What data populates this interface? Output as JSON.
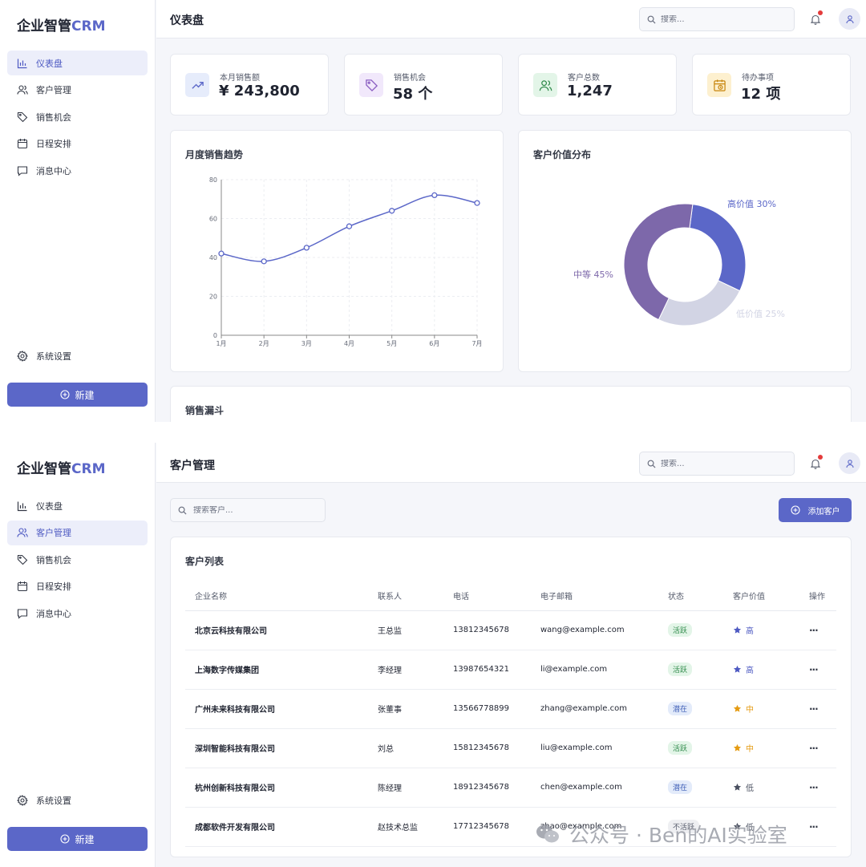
{
  "brand": {
    "name": "企业智管",
    "suffix": "CRM"
  },
  "nav": {
    "items": [
      {
        "label": "仪表盘",
        "icon": "bar-chart-icon"
      },
      {
        "label": "客户管理",
        "icon": "users-icon"
      },
      {
        "label": "销售机会",
        "icon": "tag-icon"
      },
      {
        "label": "日程安排",
        "icon": "calendar-icon"
      },
      {
        "label": "消息中心",
        "icon": "message-icon"
      }
    ],
    "settings_label": "系统设置",
    "new_label": "新建"
  },
  "header": {
    "search_placeholder": "搜索..."
  },
  "dashboard": {
    "title": "仪表盘",
    "stats": [
      {
        "label": "本月销售额",
        "value": "¥ 243,800",
        "icon": "trending-up-icon",
        "color": "#5b67c8",
        "bg": "#e6ecfb"
      },
      {
        "label": "销售机会",
        "value": "58 个",
        "icon": "tag-icon",
        "color": "#8b5fc2",
        "bg": "#f1e8fb"
      },
      {
        "label": "客户总数",
        "value": "1,247",
        "icon": "users-icon",
        "color": "#2f8a4a",
        "bg": "#e3f5e8"
      },
      {
        "label": "待办事项",
        "value": "12 项",
        "icon": "calendar-clock-icon",
        "color": "#c8850d",
        "bg": "#fdf0cf"
      }
    ],
    "line_chart_title": "月度销售趋势",
    "pie_chart_title": "客户价值分布",
    "funnel_title": "销售漏斗"
  },
  "chart_data": [
    {
      "type": "line",
      "title": "月度销售趋势",
      "x": [
        "1月",
        "2月",
        "3月",
        "4月",
        "5月",
        "6月",
        "7月"
      ],
      "series": [
        {
          "values": [
            42,
            38,
            45,
            56,
            64,
            72,
            68
          ]
        }
      ],
      "y_ticks": [
        "0",
        "20",
        "40",
        "60",
        "80"
      ],
      "ylim": [
        0,
        80
      ],
      "grid": true,
      "color": "#5b67c8"
    },
    {
      "type": "pie",
      "title": "客户价值分布",
      "donut": true,
      "slices": [
        {
          "label": "高价值 30%",
          "value": 30,
          "color": "#5b67c8"
        },
        {
          "label": "低价值 25%",
          "value": 25,
          "color": "#d2d4e4"
        },
        {
          "label": "中等 45%",
          "value": 45,
          "color": "#7d68aa"
        }
      ]
    }
  ],
  "customers": {
    "title": "客户管理",
    "search_placeholder": "搜索客户...",
    "add_label": "添加客户",
    "list_title": "客户列表",
    "columns": [
      "企业名称",
      "联系人",
      "电话",
      "电子邮箱",
      "状态",
      "客户价值",
      "操作"
    ],
    "rows": [
      {
        "company": "北京云科技有限公司",
        "contact": "王总监",
        "phone": "13812345678",
        "email": "wang@example.com",
        "status": "活跃",
        "status_type": "active",
        "value": "高",
        "value_color": "#4d59c2"
      },
      {
        "company": "上海数字传媒集团",
        "contact": "李经理",
        "phone": "13987654321",
        "email": "li@example.com",
        "status": "活跃",
        "status_type": "active",
        "value": "高",
        "value_color": "#4d59c2"
      },
      {
        "company": "广州未来科技有限公司",
        "contact": "张董事",
        "phone": "13566778899",
        "email": "zhang@example.com",
        "status": "潜在",
        "status_type": "potential",
        "value": "中",
        "value_color": "#e59b12"
      },
      {
        "company": "深圳智能科技有限公司",
        "contact": "刘总",
        "phone": "15812345678",
        "email": "liu@example.com",
        "status": "活跃",
        "status_type": "active",
        "value": "中",
        "value_color": "#e59b12"
      },
      {
        "company": "杭州创新科技有限公司",
        "contact": "陈经理",
        "phone": "18912345678",
        "email": "chen@example.com",
        "status": "潜在",
        "status_type": "potential",
        "value": "低",
        "value_color": "#4a5060"
      },
      {
        "company": "成都软件开发有限公司",
        "contact": "赵技术总监",
        "phone": "17712345678",
        "email": "zhao@example.com",
        "status": "不活跃",
        "status_type": "inactive",
        "value": "低",
        "value_color": "#4a5060"
      }
    ],
    "more_label": "···"
  },
  "watermark": "公众号 · Ben的AI实验室"
}
